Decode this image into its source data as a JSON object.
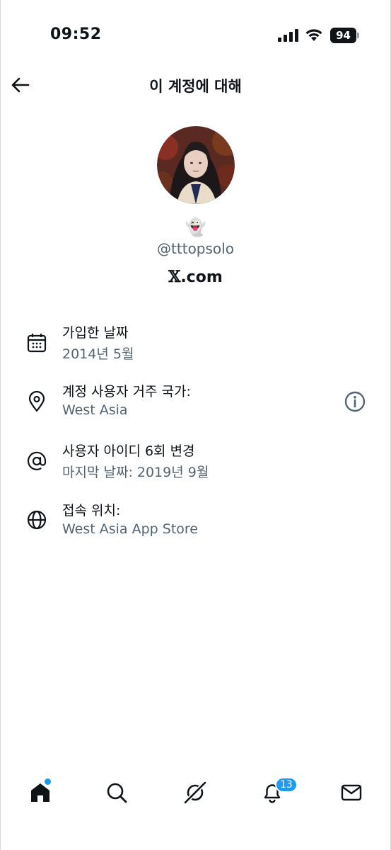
{
  "status_bar": {
    "time": "09:52",
    "battery_level": "94",
    "icons": [
      "cellular-signal-icon",
      "wifi-icon",
      "battery-icon"
    ]
  },
  "header": {
    "back_icon": "arrow-left-icon",
    "title": "이 계정에 대해"
  },
  "profile": {
    "emoji": "👻",
    "handle": "@tttopsolo",
    "affiliation_prefix": "𝕏",
    "affiliation_suffix": ".com"
  },
  "info": [
    {
      "icon": "calendar-icon",
      "title": "가입한 날짜",
      "subtitle": "2014년 5월"
    },
    {
      "icon": "location-pin-icon",
      "title": "계정 사용자 거주 국가:",
      "subtitle": "West Asia",
      "action_icon": "info-circle-icon"
    },
    {
      "icon": "at-sign-icon",
      "title": "사용자 아이디 6회 변경",
      "subtitle": "마지막 날짜: 2019년 9월"
    },
    {
      "icon": "globe-icon",
      "title": "접속 위치:",
      "subtitle": "West Asia App Store"
    }
  ],
  "bottom_nav": {
    "items": [
      "home-icon",
      "search-icon",
      "grok-icon",
      "notifications-icon",
      "messages-icon"
    ],
    "notification_count": "13"
  },
  "colors": {
    "text_primary": "#0f1419",
    "text_secondary": "#536471",
    "accent": "#1d9bf0",
    "background": "#ffffff"
  }
}
